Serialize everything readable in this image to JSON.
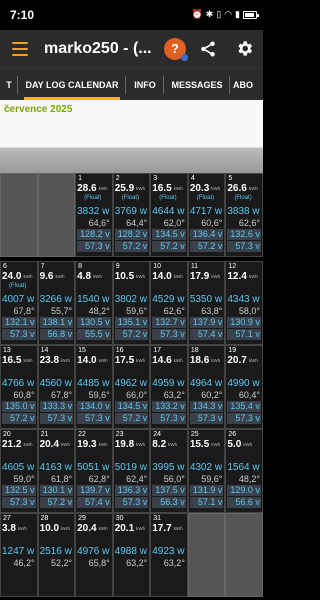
{
  "status": {
    "time": "7:10",
    "icons": [
      "alarm-icon",
      "bluetooth-icon",
      "vibrate-icon",
      "wifi-icon",
      "signal-icon",
      "battery-icon"
    ],
    "battery": ""
  },
  "appbar": {
    "title": "marko250 - (...",
    "menu_icon": "hamburger-icon",
    "avatar_icon": "help-icon",
    "share_icon": "share-icon",
    "settings_icon": "gear-icon",
    "accent": "#f0a020"
  },
  "tabs": [
    {
      "label": "T",
      "active": false
    },
    {
      "label": "DAY LOG CALENDAR",
      "active": true
    },
    {
      "label": "INFO",
      "active": false
    },
    {
      "label": "MESSAGES",
      "active": false
    },
    {
      "label": "ABO",
      "active": false
    }
  ],
  "month": {
    "label": "července 2025"
  },
  "kwh_unit": "kWh",
  "days": [
    {
      "n": "1",
      "kwh": "28.6",
      "flt": "(Float)",
      "pw": "3832 w",
      "pct": "64,6°",
      "v1": "128.2 v",
      "v2": "57.3 v"
    },
    {
      "n": "2",
      "kwh": "25.9",
      "flt": "(Float)",
      "pw": "3769 w",
      "pct": "64,4°",
      "v1": "128.2 v",
      "v2": "57.2 v"
    },
    {
      "n": "3",
      "kwh": "16.5",
      "flt": "(Float)",
      "pw": "4644 w",
      "pct": "62,0°",
      "v1": "134.5 v",
      "v2": "57.2 v"
    },
    {
      "n": "4",
      "kwh": "20.3",
      "flt": "(Float)",
      "pw": "4717 w",
      "pct": "60,6°",
      "v1": "136.4 v",
      "v2": "57.2 v"
    },
    {
      "n": "5",
      "kwh": "26.6",
      "flt": "(Float)",
      "pw": "3838 w",
      "pct": "62,6°",
      "v1": "132.6 v",
      "v2": "57.3 v"
    },
    {
      "n": "6",
      "kwh": "24.0",
      "flt": "(Float)",
      "pw": "4007 w",
      "pct": "67,8°",
      "v1": "132.1 v",
      "v2": "57.3 v"
    },
    {
      "n": "7",
      "kwh": "9.6",
      "flt": "",
      "pw": "3266 w",
      "pct": "55,7°",
      "v1": "138.1 v",
      "v2": "56.8 v"
    },
    {
      "n": "8",
      "kwh": "4.8",
      "flt": "",
      "pw": "1540 w",
      "pct": "48,2°",
      "v1": "130.5 v",
      "v2": "55.5 v"
    },
    {
      "n": "9",
      "kwh": "10.5",
      "flt": "",
      "pw": "3802 w",
      "pct": "59,6°",
      "v1": "135.1 v",
      "v2": "57.2 v"
    },
    {
      "n": "10",
      "kwh": "14.0",
      "flt": "",
      "pw": "4529 w",
      "pct": "62,6°",
      "v1": "132.7 v",
      "v2": "57.3 v"
    },
    {
      "n": "11",
      "kwh": "17.9",
      "flt": "",
      "pw": "5350 w",
      "pct": "63,8°",
      "v1": "137.9 v",
      "v2": "57.4 v"
    },
    {
      "n": "12",
      "kwh": "12.4",
      "flt": "",
      "pw": "4343 w",
      "pct": "58,0°",
      "v1": "130.9 v",
      "v2": "57.1 v"
    },
    {
      "n": "13",
      "kwh": "16.5",
      "flt": "",
      "pw": "4766 w",
      "pct": "60,8°",
      "v1": "135.0 v",
      "v2": "57.2 v"
    },
    {
      "n": "14",
      "kwh": "23.8",
      "flt": "",
      "pw": "4560 w",
      "pct": "67,8°",
      "v1": "133.3 v",
      "v2": "57.3 v"
    },
    {
      "n": "15",
      "kwh": "14.0",
      "flt": "",
      "pw": "4485 w",
      "pct": "59,6°",
      "v1": "134.0 v",
      "v2": "57.3 v"
    },
    {
      "n": "16",
      "kwh": "17.5",
      "flt": "",
      "pw": "4962 w",
      "pct": "66,0°",
      "v1": "134.5 v",
      "v2": "57.2 v"
    },
    {
      "n": "17",
      "kwh": "14.6",
      "flt": "",
      "pw": "4959 w",
      "pct": "63,2°",
      "v1": "133.2 v",
      "v2": "57.3 v"
    },
    {
      "n": "18",
      "kwh": "18.6",
      "flt": "",
      "pw": "4964 w",
      "pct": "60,2°",
      "v1": "134.3 v",
      "v2": "57.3 v"
    },
    {
      "n": "19",
      "kwh": "20.7",
      "flt": "",
      "pw": "4990 w",
      "pct": "60,4°",
      "v1": "135.4 v",
      "v2": "57.3 v"
    },
    {
      "n": "20",
      "kwh": "21.2",
      "flt": "",
      "pw": "4605 w",
      "pct": "59,0°",
      "v1": "132.5 v",
      "v2": "57.3 v"
    },
    {
      "n": "21",
      "kwh": "20.4",
      "flt": "",
      "pw": "4163 w",
      "pct": "61,8°",
      "v1": "130.1 v",
      "v2": "57.2 v"
    },
    {
      "n": "22",
      "kwh": "19.3",
      "flt": "",
      "pw": "5051 w",
      "pct": "62,8°",
      "v1": "139.7 v",
      "v2": "57.4 v"
    },
    {
      "n": "23",
      "kwh": "19.8",
      "flt": "",
      "pw": "5019 w",
      "pct": "62,4°",
      "v1": "136.3 v",
      "v2": "57.3 v"
    },
    {
      "n": "24",
      "kwh": "8.2",
      "flt": "",
      "pw": "3995 w",
      "pct": "56,0°",
      "v1": "137.5 v",
      "v2": "56.3 v"
    },
    {
      "n": "25",
      "kwh": "15.5",
      "flt": "",
      "pw": "4302 w",
      "pct": "59,6°",
      "v1": "131.9 v",
      "v2": "57.1 v"
    },
    {
      "n": "26",
      "kwh": "5.0",
      "flt": "",
      "pw": "1564 w",
      "pct": "48,2°",
      "v1": "129.0 v",
      "v2": "56.6 v"
    },
    {
      "n": "27",
      "kwh": "3.8",
      "flt": "",
      "pw": "1247 w",
      "pct": "46,2°",
      "v1": "",
      "v2": ""
    },
    {
      "n": "28",
      "kwh": "10.0",
      "flt": "",
      "pw": "2516 w",
      "pct": "52,2°",
      "v1": "",
      "v2": ""
    },
    {
      "n": "29",
      "kwh": "20.4",
      "flt": "",
      "pw": "4976 w",
      "pct": "65,8°",
      "v1": "",
      "v2": ""
    },
    {
      "n": "30",
      "kwh": "20.1",
      "flt": "",
      "pw": "4988 w",
      "pct": "63,2°",
      "v1": "",
      "v2": ""
    },
    {
      "n": "31",
      "kwh": "17.7",
      "flt": "",
      "pw": "4923 w",
      "pct": "63,2°",
      "v1": "",
      "v2": ""
    }
  ]
}
